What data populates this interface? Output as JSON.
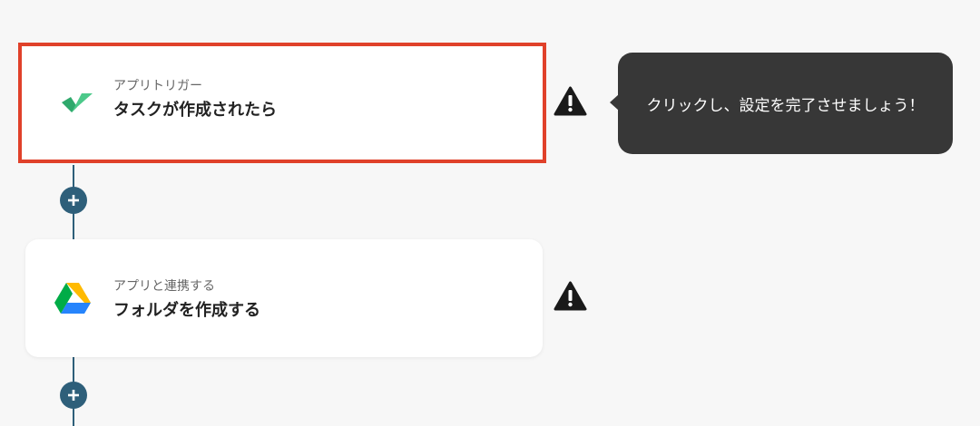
{
  "flow": {
    "steps": [
      {
        "type_label": "アプリトリガー",
        "title": "タスクが作成されたら",
        "app_icon": "check-mark-logo-icon",
        "selected": true,
        "warning_icon": "warning-triangle-icon"
      },
      {
        "type_label": "アプリと連携する",
        "title": "フォルダを作成する",
        "app_icon": "google-drive-icon",
        "selected": false,
        "warning_icon": "warning-triangle-icon"
      }
    ],
    "add_step_icon": "plus-icon"
  },
  "tooltip": {
    "text": "クリックし、設定を完了させましょう！"
  },
  "colors": {
    "background": "#f7f7f7",
    "connector": "#2e5f7a",
    "selected_border": "#e0412a",
    "tooltip_bg": "#373737",
    "trigger_logo": "#3dbd7d"
  }
}
